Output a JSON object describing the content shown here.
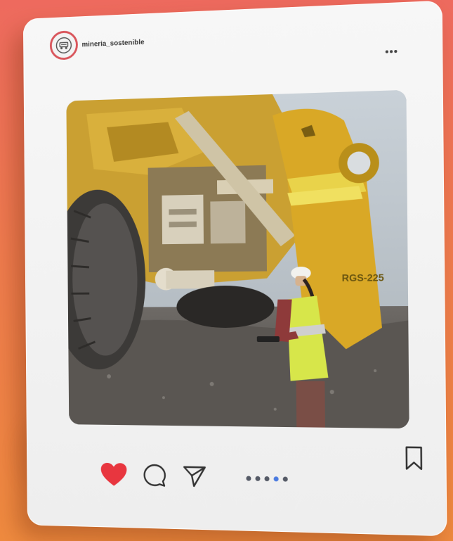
{
  "post": {
    "username": "mineria_sostenible",
    "more_icon": "more-horizontal-icon",
    "photo_subject": "photo"
  },
  "actions": {
    "like_icon": "heart-filled-icon",
    "comment_icon": "comment-icon",
    "share_icon": "send-icon",
    "save_icon": "bookmark-icon"
  },
  "carousel": {
    "total": 5,
    "active_index": 3
  },
  "colors": {
    "background_top": "#ee6a5e",
    "background_bottom": "#ef8a3e",
    "heart": "#e8363f",
    "avatar_ring": "#d9555b",
    "active_dot": "#4b7be0"
  }
}
